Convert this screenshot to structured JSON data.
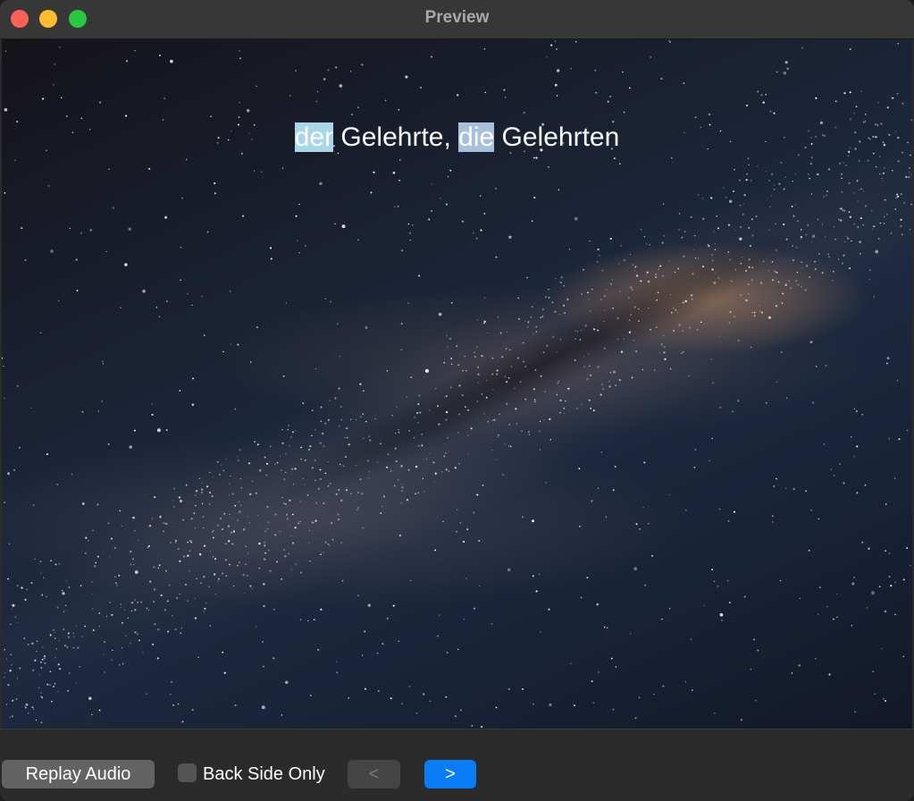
{
  "window": {
    "title": "Preview"
  },
  "card": {
    "word1_article": "der",
    "word1_noun": " Gelehrte, ",
    "word2_article": "die",
    "word2_noun": " Gelehrten",
    "background": "milky-way-night-sky-image",
    "highlight_colors": [
      "#a9d6e8",
      "#a7c0dc"
    ]
  },
  "controls": {
    "replay_label": "Replay Audio",
    "back_side_only_label": "Back Side Only",
    "back_side_only_checked": false,
    "prev_label": "<",
    "next_label": ">",
    "accent": "#0a7cf5"
  }
}
